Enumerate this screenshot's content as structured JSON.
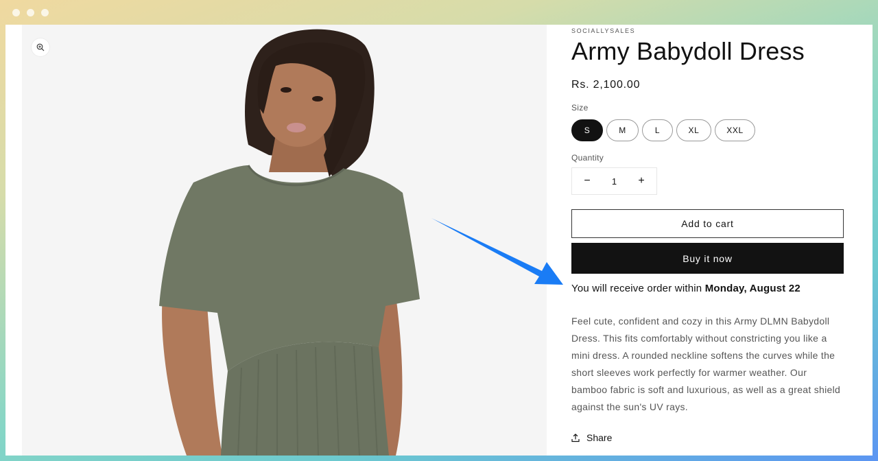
{
  "window": {
    "controls": [
      "dot",
      "dot",
      "dot"
    ]
  },
  "media": {
    "zoom_icon": "zoom-in-icon",
    "image_alt": "Model wearing army green babydoll dress",
    "colors": {
      "background": "#f5f5f5",
      "dress": "#6f7663",
      "skin": "#b07a5a",
      "hair": "#2e211b"
    }
  },
  "product": {
    "vendor": "SOCIALLYSALES",
    "title": "Army Babydoll Dress",
    "price": "Rs. 2,100.00",
    "size_label": "Size",
    "sizes": [
      {
        "label": "S",
        "selected": true
      },
      {
        "label": "M",
        "selected": false
      },
      {
        "label": "L",
        "selected": false
      },
      {
        "label": "XL",
        "selected": false
      },
      {
        "label": "XXL",
        "selected": false
      }
    ],
    "quantity_label": "Quantity",
    "quantity": {
      "decrement": "−",
      "value": "1",
      "increment": "+"
    },
    "add_to_cart": "Add to cart",
    "buy_now": "Buy it now",
    "delivery": {
      "prefix": "You will receive order within ",
      "date": "Monday, August 22"
    },
    "description": "Feel cute, confident and cozy in this Army DLMN Babydoll Dress. This fits comfortably without constricting you like a mini dress. A rounded neckline softens the curves while the short sleeves work perfectly for warmer weather. Our bamboo fabric is soft and luxurious, as well as a great shield against the sun's UV rays.",
    "share": "Share"
  },
  "annotation": {
    "arrow_color": "#1a7cf5"
  }
}
